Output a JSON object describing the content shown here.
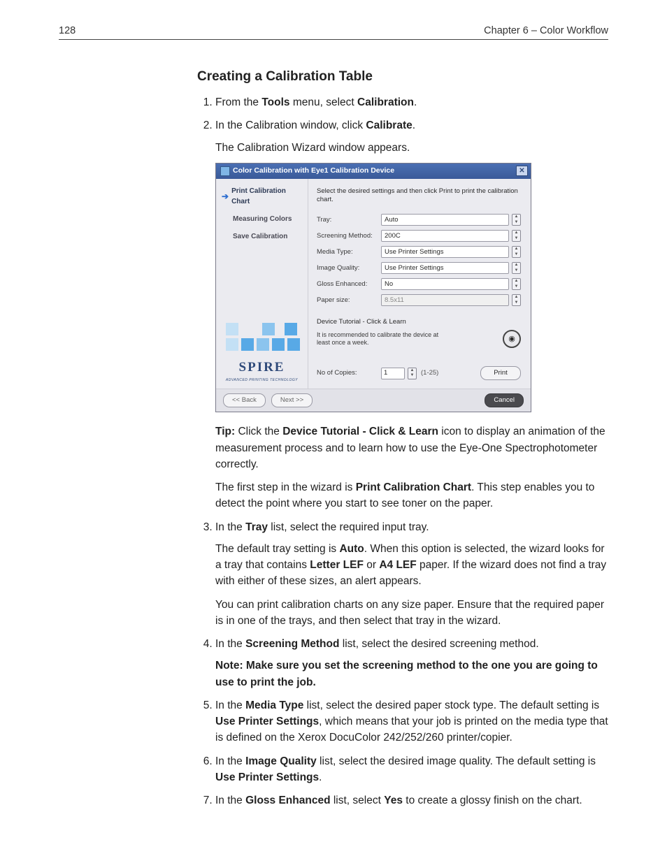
{
  "header": {
    "page_number": "128",
    "chapter": "Chapter 6 – Color Workflow"
  },
  "section_title": "Creating a Calibration Table",
  "steps": {
    "s1a": "From the ",
    "s1_tools": "Tools",
    "s1b": " menu, select ",
    "s1_calibration": "Calibration",
    "s1c": ".",
    "s2a": "In the Calibration window, click ",
    "s2_calibrate": "Calibrate",
    "s2b": ".",
    "s2_line": "The Calibration Wizard window appears.",
    "s3a": "In the ",
    "s3_tray": "Tray",
    "s3b": " list, select the required input tray.",
    "s3_p1a": "The default tray setting is ",
    "s3_auto": "Auto",
    "s3_p1b": ". When this option is selected, the wizard looks for a tray that contains ",
    "s3_letter": "Letter LEF",
    "s3_p1c": " or ",
    "s3_a4": "A4 LEF",
    "s3_p1d": " paper. If the wizard does not find a tray with either of these sizes, an alert appears.",
    "s3_p2": "You can print calibration charts on any size paper. Ensure that the required paper is in one of the trays, and then select that tray in the wizard.",
    "s4a": "In the ",
    "s4_sm": "Screening Method",
    "s4b": " list, select the desired screening method.",
    "s4_note_pre": "Note:  ",
    "s4_note": "Make sure you set the screening method to the one you are going to use to print the job.",
    "s5a": "In the ",
    "s5_mt": "Media Type",
    "s5b": " list, select the desired paper stock type. The default setting is ",
    "s5_ups": "Use Printer Settings",
    "s5c": ", which means that your job is printed on the media type that is defined on the Xerox DocuColor 242/252/260 printer/copier.",
    "s6a": "In the ",
    "s6_iq": "Image Quality",
    "s6b": " list, select the desired image quality. The default setting is ",
    "s6_ups": "Use Printer Settings",
    "s6c": ".",
    "s7a": "In the ",
    "s7_ge": "Gloss Enhanced",
    "s7b": " list, select ",
    "s7_yes": "Yes",
    "s7c": " to create a glossy finish on the chart."
  },
  "tip": {
    "pre": "Tip:  ",
    "a": "Click the ",
    "bold": "Device Tutorial - Click & Learn",
    "b": " icon to display an animation of the measurement process and to learn how to use the Eye-One Spectrophotometer correctly."
  },
  "midpara": {
    "a": "The first step in the wizard is ",
    "bold": "Print Calibration Chart",
    "b": ". This step enables you to detect the point where you start to see toner on the paper."
  },
  "dialog": {
    "title": "Color Calibration with Eye1 Calibration Device",
    "sidebar": {
      "step1": "Print Calibration Chart",
      "step2": "Measuring Colors",
      "step3": "Save Calibration",
      "logo": "SPIRE",
      "tag": "Advanced Printing Technology"
    },
    "instr": "Select the desired settings and then click Print to print the calibration chart.",
    "labels": {
      "tray": "Tray:",
      "screening": "Screening Method:",
      "media": "Media Type:",
      "quality": "Image Quality:",
      "gloss": "Gloss Enhanced:",
      "paper": "Paper size:",
      "copies": "No of Copies:"
    },
    "values": {
      "tray": "Auto",
      "screening": "200C",
      "media": "Use Printer Settings",
      "quality": "Use Printer Settings",
      "gloss": "No",
      "paper": "8.5x11",
      "copies": "1",
      "range": "(1-25)"
    },
    "tutorial_label": "Device Tutorial - Click & Learn",
    "tutorial_text": "It is recommended to calibrate the device at least once a week.",
    "buttons": {
      "print": "Print",
      "back": "<< Back",
      "next": "Next >>",
      "cancel": "Cancel"
    }
  }
}
